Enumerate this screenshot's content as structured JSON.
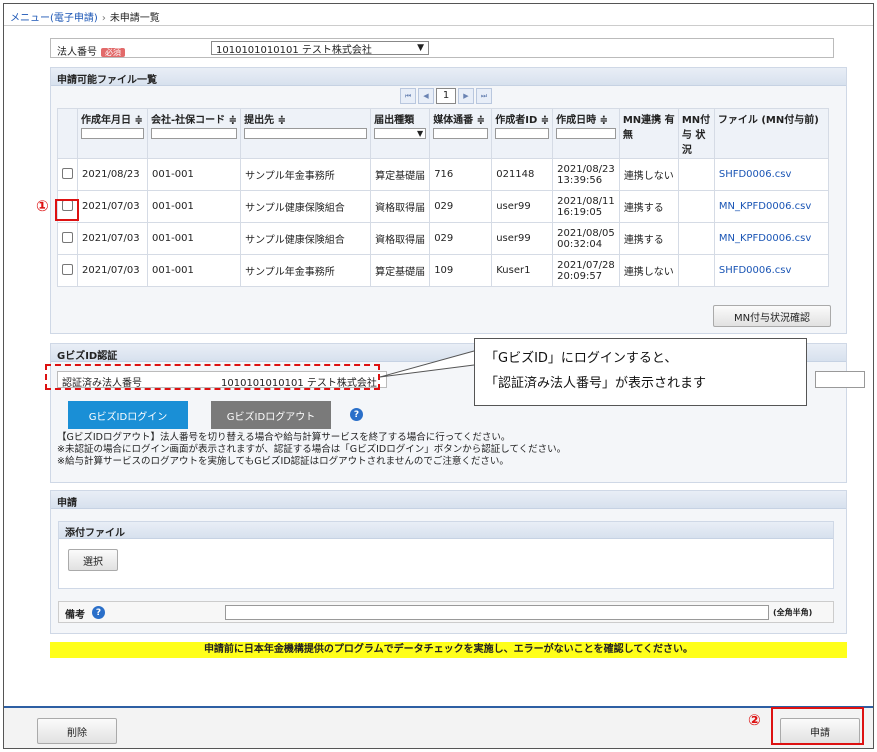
{
  "breadcrumb": {
    "parent": "メニュー(電子申請)",
    "separator": "›",
    "current": "未申請一覧"
  },
  "corp": {
    "label": "法人番号",
    "required_badge": "必須",
    "selected": "1010101010101 テスト株式会社"
  },
  "file_section": {
    "title": "申請可能ファイル一覧",
    "pager": {
      "first": "⏮",
      "prev": "◀",
      "current": "1",
      "next": "▶",
      "last": "⏭"
    },
    "headers": {
      "created_date": "作成年月日 ≑",
      "company_code": "会社-社保コード ≑",
      "submit_to": "提出先 ≑",
      "form_type": "届出種類",
      "media_no": "媒体通番 ≑",
      "creator_id": "作成者ID ≑",
      "created_at": "作成日時 ≑",
      "mn_link": "MN連携 有無",
      "mn_status": "MN付与 状況",
      "file": "ファイル (MN付与前)"
    },
    "rows": [
      {
        "date": "2021/08/23",
        "code": "001-001",
        "submit_to": "サンプル年金事務所",
        "form": "算定基礎届",
        "media": "716",
        "creator": "021148",
        "dt1": "2021/08/23",
        "dt2": "13:39:56",
        "mn": "連携しない",
        "status": "",
        "file": "SHFD0006.csv"
      },
      {
        "date": "2021/07/03",
        "code": "001-001",
        "submit_to": "サンプル健康保険組合",
        "form": "資格取得届",
        "media": "029",
        "creator": "user99",
        "dt1": "2021/08/11",
        "dt2": "16:19:05",
        "mn": "連携する",
        "status": "",
        "file": "MN_KPFD0006.csv"
      },
      {
        "date": "2021/07/03",
        "code": "001-001",
        "submit_to": "サンプル健康保険組合",
        "form": "資格取得届",
        "media": "029",
        "creator": "user99",
        "dt1": "2021/08/05",
        "dt2": "00:32:04",
        "mn": "連携する",
        "status": "",
        "file": "MN_KPFD0006.csv"
      },
      {
        "date": "2021/07/03",
        "code": "001-001",
        "submit_to": "サンプル年金事務所",
        "form": "算定基礎届",
        "media": "109",
        "creator": "Kuser1",
        "dt1": "2021/07/28",
        "dt2": "20:09:57",
        "mn": "連携しない",
        "status": "",
        "file": "SHFD0006.csv"
      }
    ],
    "mn_check_button": "MN付与状況確認"
  },
  "gbiz": {
    "title": "GビズID認証",
    "auth_label": "認証済み法人番号",
    "auth_value": "1010101010101 テスト株式会社",
    "login_button": "GビズIDログイン",
    "logout_button": "GビズIDログアウト",
    "help": "?",
    "notes": [
      "【GビズIDログアウト】法人番号を切り替える場合や給与計算サービスを終了する場合に行ってください。",
      "※未認証の場合にログイン画面が表示されますが、認証する場合は「GビズIDログイン」ボタンから認証してください。",
      "※給与計算サービスのログアウトを実施してもGビズID認証はログアウトされませんのでご注意ください。"
    ]
  },
  "callout": {
    "line1": "「GビズID」にログインすると、",
    "line2": "「認証済み法人番号」が表示されます"
  },
  "apply_section": {
    "title": "申請",
    "attach_title": "添付ファイル",
    "select_button": "選択",
    "remarks_label": "備考",
    "remarks_help": "?",
    "remarks_hint": "(全角半角)"
  },
  "warning": "申請前に日本年金機構提供のプログラムでデータチェックを実施し、エラーがないことを確認してください。",
  "footer": {
    "delete_button": "削除",
    "apply_button": "申請"
  },
  "markers": {
    "one": "①",
    "two": "②"
  },
  "colors": {
    "highlight": "#dd1111",
    "link": "#1a55b5",
    "gbiz_login": "#1a8fd6",
    "gbiz_logout": "#7a7a7a",
    "warning_bg": "#ffff1a",
    "footer_border": "#2d5fa3"
  }
}
